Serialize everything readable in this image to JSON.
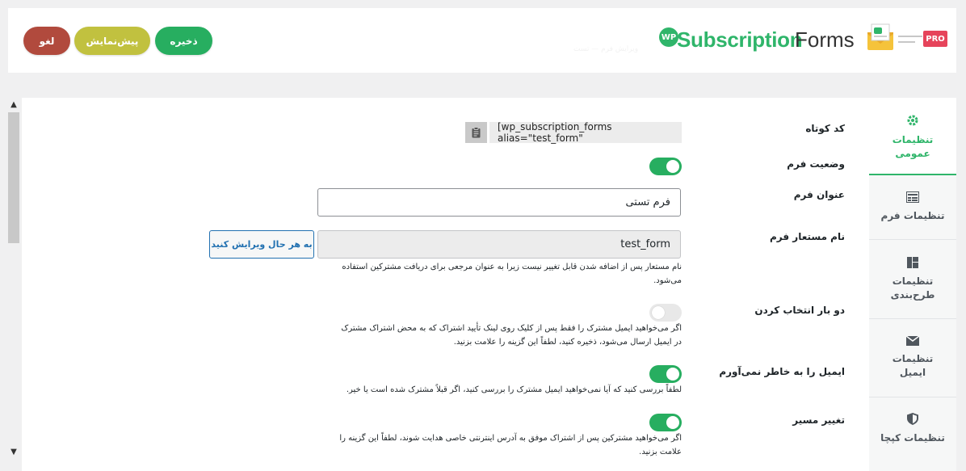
{
  "header": {
    "cancel_label": "لغو",
    "preview_label": "پیش‌نمایش",
    "save_label": "ذخیره",
    "logo": {
      "wp": "WP",
      "part1": "Subscription",
      "part2": "Forms",
      "badge": "PRO"
    },
    "subtitle": "ویرایش فرم — تست"
  },
  "tabs": [
    {
      "label": "تنظیمات عمومی",
      "icon": "gear-icon",
      "active": true
    },
    {
      "label": "تنظیمات فرم",
      "icon": "form-icon",
      "active": false
    },
    {
      "label": "تنظیمات طرح‌بندی",
      "icon": "layout-icon",
      "active": false
    },
    {
      "label": "تنظیمات ایمیل",
      "icon": "email-icon",
      "active": false
    },
    {
      "label": "تنظیمات کپچا",
      "icon": "shield-icon",
      "active": false
    }
  ],
  "form": {
    "shortcode": {
      "label": "کد کوتاه",
      "value": "[wp_subscription_forms alias=\"test_form\""
    },
    "status": {
      "label": "وضعیت فرم",
      "enabled": true
    },
    "title": {
      "label": "عنوان فرم",
      "value": "فرم تستی"
    },
    "alias": {
      "label": "نام مستعار فرم",
      "value": "test_form",
      "edit_label": "به هر حال ویرایش کنید",
      "help": "نام مستعار پس از اضافه شدن قابل تغییر نیست زیرا به عنوان مرجعی برای دریافت مشترکین استفاده می‌شود."
    },
    "double_optin": {
      "label": "دو بار انتخاب کردن",
      "enabled": false,
      "help": "اگر می‌خواهید ایمیل مشترک را فقط پس از کلیک روی لینک تأیید اشتراک که به محض اشتراک مشترک در ایمیل ارسال می‌شود، ذخیره کنید، لطفاً این گزینه را علامت بزنید."
    },
    "email_forget": {
      "label": "ایمیل را به خاطر نمی‌آورم",
      "enabled": true,
      "help": "لطفاً بررسی کنید که آیا نمی‌خواهید ایمیل مشترک را بررسی کنید، اگر قبلاً مشترک شده است یا خیر."
    },
    "redirect": {
      "label": "تغییر مسیر",
      "enabled": true,
      "help": "اگر می‌خواهید مشترکین پس از اشتراک موفق به آدرس اینترنتی خاصی هدایت شوند، لطفاً این گزینه را علامت بزنید."
    }
  },
  "colors": {
    "accent": "#27ae60",
    "cancel": "#b14a3d",
    "preview": "#c1c13f",
    "link": "#2271b1"
  }
}
